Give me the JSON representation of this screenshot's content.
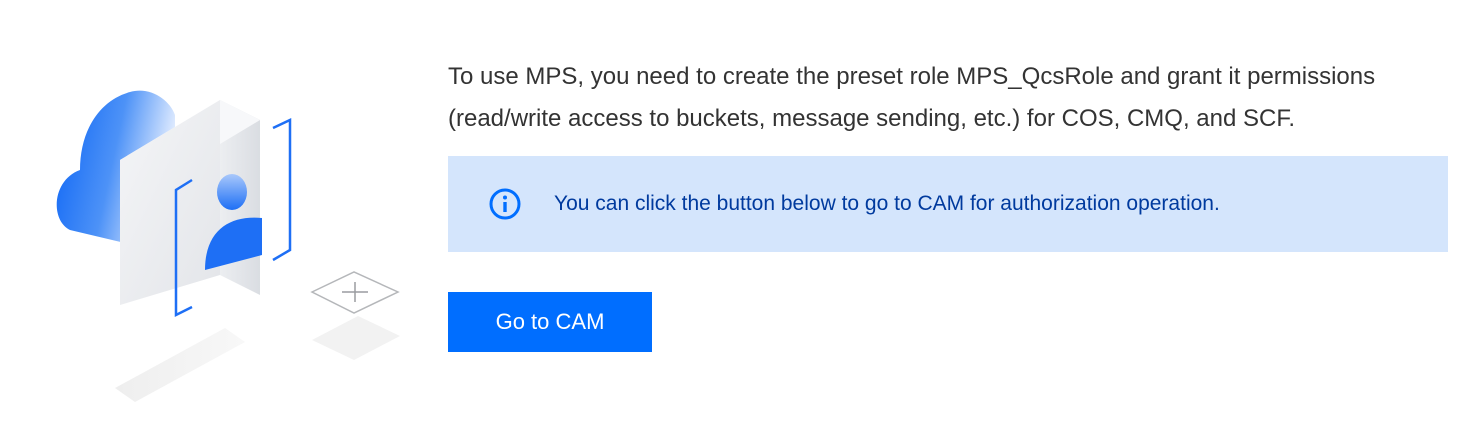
{
  "illustration": {
    "icon": "user-role-illustration"
  },
  "main": {
    "description": "To use MPS, you need to create the preset role MPS_QcsRole and grant it permissions (read/write access to buckets, message sending, etc.) for COS, CMQ, and SCF.",
    "info_icon": "info-icon",
    "info_text": "You can click the button below to go to CAM for authorization operation.",
    "button_label": "Go to CAM"
  },
  "colors": {
    "accent": "#006eff",
    "info_background": "#d4e5fc",
    "info_text": "#003a9e",
    "body_text": "#333333"
  }
}
